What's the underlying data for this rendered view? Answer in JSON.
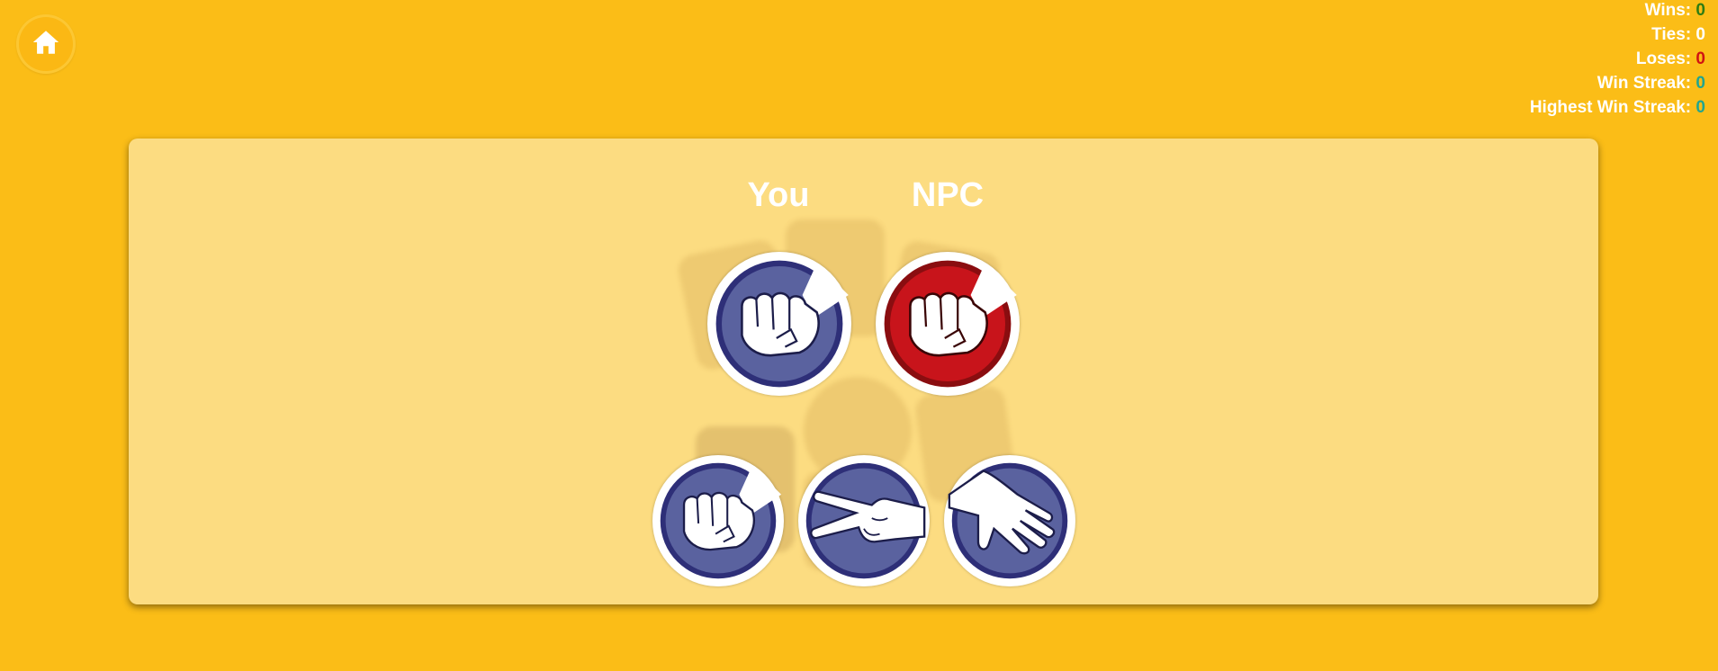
{
  "stats": {
    "wins_label": "Wins: ",
    "wins_value": "0",
    "ties_label": "Ties: ",
    "ties_value": "0",
    "loses_label": "Loses: ",
    "loses_value": "0",
    "win_streak_label": "Win Streak: ",
    "win_streak_value": "0",
    "highest_win_streak_label": "Highest Win Streak: ",
    "highest_win_streak_value": "0"
  },
  "arena": {
    "you_label": "You",
    "npc_label": "NPC",
    "you_choice": "rock",
    "npc_choice": "rock"
  },
  "options": [
    "rock",
    "scissors",
    "paper"
  ],
  "icons": {
    "home": "home-icon",
    "rock": "rock-icon",
    "scissors": "scissors-icon",
    "paper": "paper-icon"
  },
  "colors": {
    "background": "#fbbd17",
    "panel": "#fcdc81",
    "player_circle": "#5a629f",
    "player_ring": "#2e2f78",
    "npc_circle": "#c8141b",
    "npc_ring": "#8a0d10"
  }
}
